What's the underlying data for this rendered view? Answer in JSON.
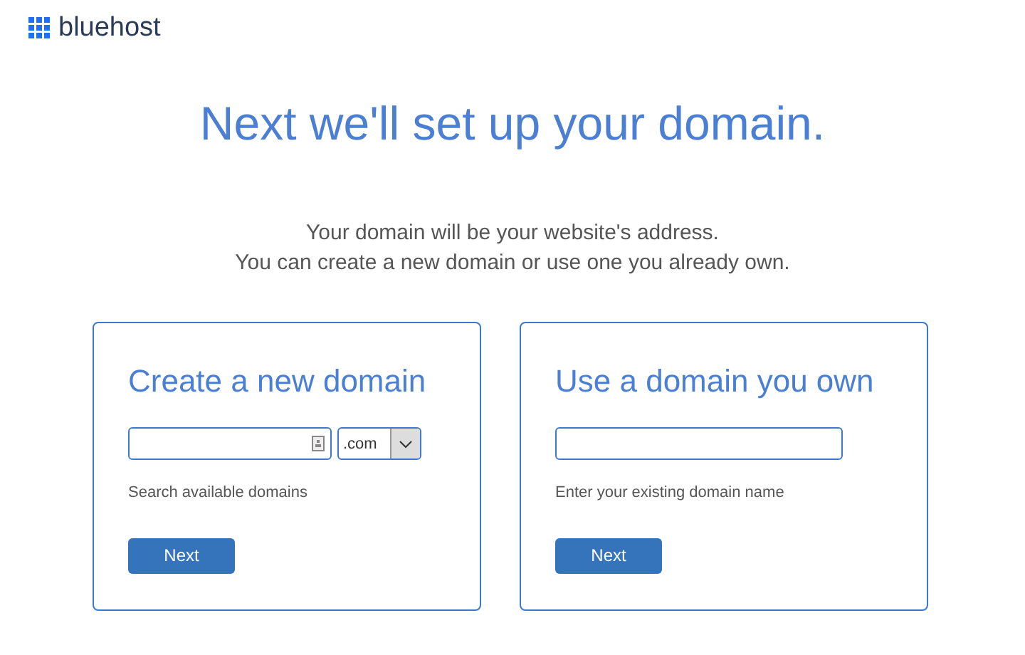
{
  "logo": {
    "text": "bluehost"
  },
  "heading": "Next we'll set up your domain.",
  "intro": [
    "Your domain will be your website's address.",
    "You can create a new domain or use one you already own."
  ],
  "cards": [
    {
      "kind": "new",
      "title": "Create a new domain",
      "tld": ".com",
      "hint": "Search available domains",
      "button": "Next"
    },
    {
      "kind": "own",
      "title": "Use a domain you own",
      "hint": "Enter your existing domain name",
      "button": "Next"
    }
  ]
}
